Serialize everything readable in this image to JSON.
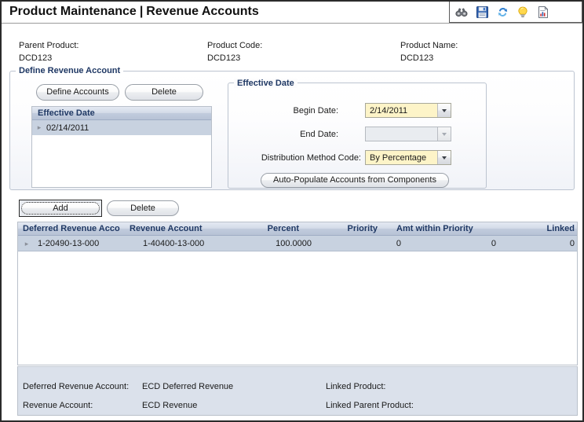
{
  "window": {
    "title_main": "Product Maintenance",
    "title_separator": "|",
    "title_sub": "Revenue Accounts"
  },
  "toolbar": {
    "items": [
      {
        "name": "binoculars-icon",
        "label": "Search"
      },
      {
        "name": "save-icon",
        "label": "Save"
      },
      {
        "name": "refresh-icon",
        "label": "Refresh"
      },
      {
        "name": "lightbulb-icon",
        "label": "Hint"
      },
      {
        "name": "report-icon",
        "label": "Report"
      }
    ]
  },
  "header": {
    "parent_product_label": "Parent Product:",
    "parent_product_value": "DCD123",
    "product_code_label": "Product Code:",
    "product_code_value": "DCD123",
    "product_name_label": "Product Name:",
    "product_name_value": "DCD123"
  },
  "define_revenue_account": {
    "legend": "Define Revenue Account",
    "define_accounts_button": "Define Accounts",
    "delete_button": "Delete",
    "list": {
      "header": "Effective Date",
      "rows": [
        {
          "date": "02/14/2011"
        }
      ]
    }
  },
  "effective_date_panel": {
    "legend": "Effective Date",
    "begin_date_label": "Begin Date:",
    "begin_date_value": "2/14/2011",
    "end_date_label": "End Date:",
    "end_date_value": "",
    "distribution_method_label": "Distribution Method Code:",
    "distribution_method_value": "By Percentage",
    "auto_populate_button": "Auto-Populate Accounts from Components"
  },
  "grid_toolbar": {
    "add_button": "Add",
    "delete_button": "Delete"
  },
  "grid": {
    "columns": [
      "Deferred Revenue Acco",
      "Revenue Account",
      "Percent",
      "Priority",
      "Amt within Priority",
      "Linked"
    ],
    "rows": [
      {
        "deferred_revenue_account": "1-20490-13-000",
        "revenue_account": "1-40400-13-000",
        "percent": "100.0000",
        "priority": "0",
        "amt_within_priority": "0",
        "linked": "0"
      }
    ]
  },
  "detail_panel": {
    "deferred_revenue_account_label": "Deferred Revenue Account:",
    "deferred_revenue_account_value": "ECD Deferred Revenue",
    "revenue_account_label": "Revenue Account:",
    "revenue_account_value": "ECD Revenue",
    "linked_product_label": "Linked Product:",
    "linked_product_value": "",
    "linked_parent_product_label": "Linked Parent Product:",
    "linked_parent_product_value": ""
  },
  "colors": {
    "accent_header_text": "#1f3864",
    "grid_selection": "#c8d2e0",
    "input_highlight": "#fdf4c8",
    "panel_bg": "#dbe1eb"
  }
}
